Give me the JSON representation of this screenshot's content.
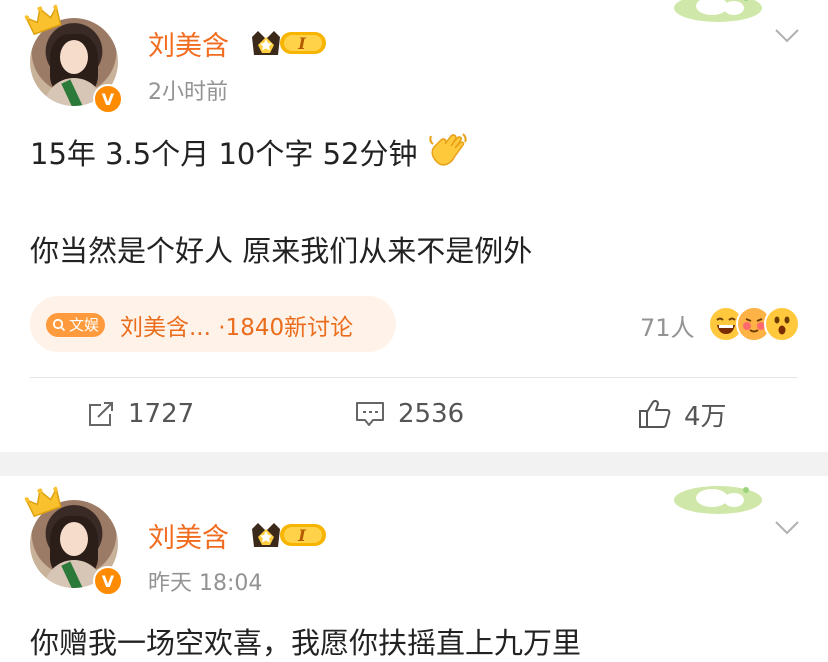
{
  "posts": [
    {
      "author": "刘美含",
      "time": "2小时前",
      "text_line1": "15年 3.5个月 10个字 52分钟",
      "text_line2": "你当然是个好人   原来我们从来不是例外",
      "topic": {
        "tag": "文娱",
        "label": "刘美含... ·1840新讨论"
      },
      "reactions": {
        "count": "71人"
      },
      "actions": {
        "repost": "1727",
        "comment": "2536",
        "like": "4万"
      }
    },
    {
      "author": "刘美含",
      "time": "昨天 18:04",
      "text_line1": "你赠我一场空欢喜，我愿你扶摇直上九万里"
    }
  ],
  "badges": {
    "verified": "V",
    "level": "I"
  },
  "icons": [
    "crown-icon",
    "verified-icon",
    "level-badge-icon",
    "sticker-icon",
    "chevron-down-icon",
    "waving-hand-icon",
    "search-icon",
    "repost-icon",
    "comment-icon",
    "like-icon"
  ],
  "colors": {
    "name": "#f26c1f",
    "topic_bg": "#fff2e8",
    "topic_text": "#ea6d1d",
    "meta": "#939393",
    "separator": "#f2f2f2"
  }
}
